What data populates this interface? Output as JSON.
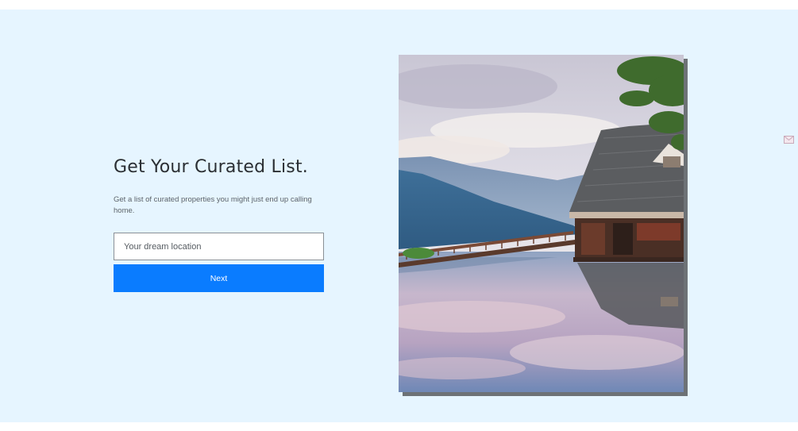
{
  "signup": {
    "headline": "Get Your Curated List.",
    "subtitle": "Get a list of curated properties you might just end up calling home.",
    "location_input": {
      "placeholder": "Your dream location",
      "value": ""
    },
    "next_label": "Next"
  },
  "hero_image": {
    "icon": "lakeside-house-photo"
  },
  "side_icon": {
    "icon": "envelope-icon"
  },
  "colors": {
    "background": "#e6f5ff",
    "accent": "#0a7cff",
    "headline": "#2b2f33",
    "subtitle": "#5d646b"
  }
}
